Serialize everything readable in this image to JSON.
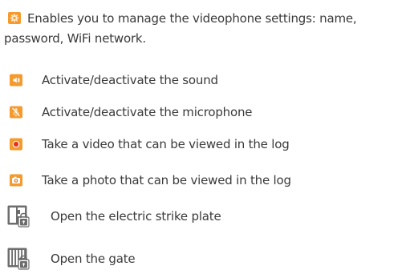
{
  "colors": {
    "icon_orange": "#f59a2c",
    "icon_orange_dark": "#e4761a",
    "icon_record_red": "#e7321f",
    "icon_gray": "#6d6d6d",
    "text": "#3a3a3a"
  },
  "intro": {
    "icon": "settings-gear-icon",
    "text": "Enables you to manage the videophone settings: name, password, WiFi network."
  },
  "items": [
    {
      "icon": "speaker-sound-icon",
      "label": "Activate/deactivate the sound"
    },
    {
      "icon": "microphone-icon",
      "label": "Activate/deactivate the microphone"
    },
    {
      "icon": "record-video-icon",
      "label": "Take a video that can be viewed in the log"
    },
    {
      "icon": "camera-photo-icon",
      "label": "Take a photo that can be viewed in the log"
    },
    {
      "icon": "strike-plate-lock-icon",
      "label": "Open the electric strike plate"
    },
    {
      "icon": "gate-lock-icon",
      "label": "Open the gate"
    }
  ]
}
